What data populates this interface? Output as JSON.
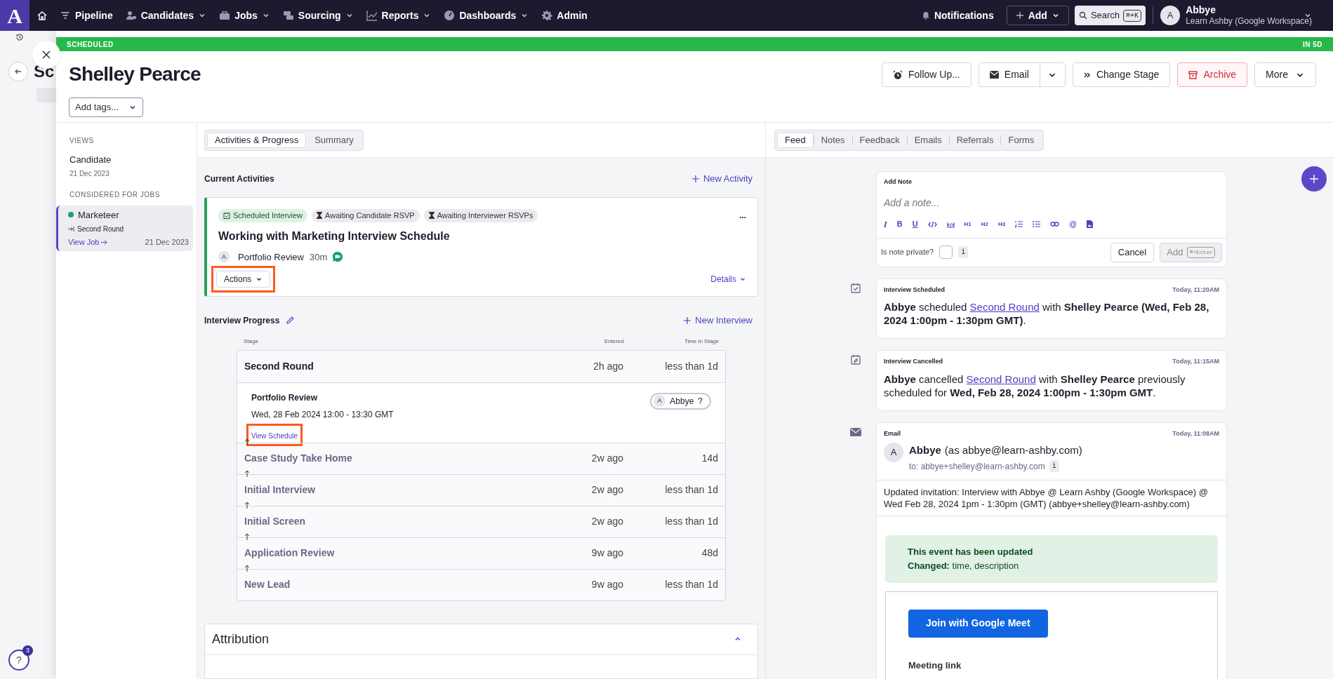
{
  "nav": {
    "logo": "A",
    "items": [
      {
        "label": "Pipeline",
        "dropdown": false
      },
      {
        "label": "Candidates",
        "dropdown": true
      },
      {
        "label": "Jobs",
        "dropdown": true
      },
      {
        "label": "Sourcing",
        "dropdown": true
      },
      {
        "label": "Reports",
        "dropdown": true
      },
      {
        "label": "Dashboards",
        "dropdown": true
      },
      {
        "label": "Admin",
        "dropdown": false
      }
    ],
    "notifications": "Notifications",
    "add": "Add",
    "search": "Search",
    "search_shortcut": "⌘+K",
    "user": {
      "avatar": "A",
      "name": "Abbye",
      "org": "Learn Ashby (Google Workspace)"
    }
  },
  "background_page": {
    "title": "Sc"
  },
  "status_bar": {
    "label": "SCHEDULED",
    "due": "IN 5D"
  },
  "candidate": {
    "name": "Shelley Pearce",
    "tags_placeholder": "Add tags..."
  },
  "actions": [
    {
      "kind": "follow-up",
      "label": "Follow Up..."
    },
    {
      "kind": "email",
      "label": "Email"
    },
    {
      "kind": "change-stage",
      "label": "Change Stage"
    },
    {
      "kind": "archive",
      "label": "Archive"
    },
    {
      "kind": "more",
      "label": "More"
    }
  ],
  "sidebar": {
    "views_heading": "VIEWS",
    "views": [
      {
        "label": "Candidate",
        "date": "21 Dec 2023"
      }
    ],
    "jobs_heading": "CONSIDERED FOR JOBS",
    "jobs": [
      {
        "title": "Marketeer",
        "color": "#22a06b",
        "stage": "Second Round",
        "link": "View Job",
        "date": "21 Dec 2023",
        "selected": true
      }
    ]
  },
  "main_tabs": [
    {
      "label": "Activities & Progress",
      "selected": true
    },
    {
      "label": "Summary",
      "selected": false
    }
  ],
  "current_activities": {
    "heading": "Current Activities",
    "new_button": "New Activity",
    "activity": {
      "tags": [
        {
          "kind": "scheduled",
          "label": "Scheduled Interview"
        },
        {
          "kind": "awaiting",
          "label": "Awaiting Candidate RSVP"
        },
        {
          "kind": "awaiting",
          "label": "Awaiting Interviewer RSVPs"
        }
      ],
      "menu": "...",
      "title": "Working with Marketing Interview Schedule",
      "interview": {
        "avatar": "A",
        "name": "Portfolio Review",
        "duration": "30m"
      },
      "actions_button": {
        "label": "Actions",
        "highlighted": true
      },
      "details": "Details"
    }
  },
  "interview_progress": {
    "heading": "Interview Progress",
    "new_button": "New Interview",
    "columns": [
      "Stage",
      "Entered",
      "Time in Stage"
    ],
    "stages": [
      {
        "name": "Second Round",
        "entered": "2h ago",
        "time": "less than 1d",
        "current": true,
        "interviews": [
          {
            "name": "Portfolio Review",
            "when": "Wed, 28 Feb 2024 13:00 - 13:30 GMT",
            "link": "View Schedule",
            "highlighted": true,
            "interviewer": {
              "avatar": "A",
              "name": "Abbye",
              "status": "?"
            }
          }
        ]
      },
      {
        "name": "Case Study Take Home",
        "entered": "2w ago",
        "time": "14d",
        "current": false
      },
      {
        "name": "Initial Interview",
        "entered": "2w ago",
        "time": "less than 1d",
        "current": false
      },
      {
        "name": "Initial Screen",
        "entered": "2w ago",
        "time": "less than 1d",
        "current": false
      },
      {
        "name": "Application Review",
        "entered": "9w ago",
        "time": "48d",
        "current": false
      },
      {
        "name": "New Lead",
        "entered": "9w ago",
        "time": "less than 1d",
        "current": false
      }
    ]
  },
  "attribution": {
    "heading": "Attribution",
    "expanded": true
  },
  "feed_tabs": [
    {
      "label": "Feed",
      "selected": true
    },
    {
      "label": "Notes",
      "selected": false
    },
    {
      "label": "Feedback",
      "selected": false
    },
    {
      "label": "Emails",
      "selected": false
    },
    {
      "label": "Referrals",
      "selected": false
    },
    {
      "label": "Forms",
      "selected": false
    }
  ],
  "note": {
    "heading": "Add Note",
    "placeholder": "Add a note...",
    "toolbar": [
      {
        "kind": "italic",
        "label": "I"
      },
      {
        "kind": "bold",
        "label": "B"
      },
      {
        "kind": "underline",
        "label": "U"
      },
      {
        "kind": "code"
      },
      {
        "kind": "code-block"
      },
      {
        "kind": "heading",
        "label": "H1"
      },
      {
        "kind": "heading",
        "label": "H2"
      },
      {
        "kind": "heading",
        "label": "H3"
      },
      {
        "kind": "ordered-list"
      },
      {
        "kind": "bullet-list"
      },
      {
        "kind": "link"
      },
      {
        "kind": "mention",
        "label": "@"
      },
      {
        "kind": "file"
      }
    ],
    "private_label": "Is note private?",
    "private": false,
    "info": "i",
    "cancel": "Cancel",
    "add": "Add",
    "add_shortcut": "⌘+Enter"
  },
  "feed": [
    {
      "kind": "scheduled",
      "title": "Interview Scheduled",
      "time": "Today, 11:20AM",
      "before": "**Abbye** scheduled ",
      "link": "Second Round",
      "after": " with **Shelley Pearce (Wed, Feb 28, 2024 1:00pm - 1:30pm GMT)**."
    },
    {
      "kind": "cancelled",
      "title": "Interview Cancelled",
      "time": "Today, 11:15AM",
      "before": "**Abbye** cancelled ",
      "link": "Second Round",
      "after": " with **Shelley Pearce** previously scheduled for **Wed, Feb 28, 2024 1:00pm - 1:30pm GMT**."
    },
    {
      "kind": "email",
      "title": "Email",
      "time": "Today, 11:08AM",
      "sender": {
        "avatar": "A",
        "name": "Abbye",
        "as": "(as abbye@learn-ashby.com)"
      },
      "to": "to: abbye+shelley@learn-ashby.com",
      "info": "i",
      "subject": "Updated invitation: Interview with Abbye @ Learn Ashby (Google Workspace) @ Wed Feb 28, 2024 1pm - 1:30pm (GMT) (abbye+shelley@learn-ashby.com)",
      "notice_title": "This event has been updated",
      "notice_detail": "**Changed:** time, description",
      "join_button": "Join with Google Meet",
      "meeting_heading": "Meeting link"
    }
  ],
  "help": {
    "label": "?",
    "badge": "3"
  }
}
